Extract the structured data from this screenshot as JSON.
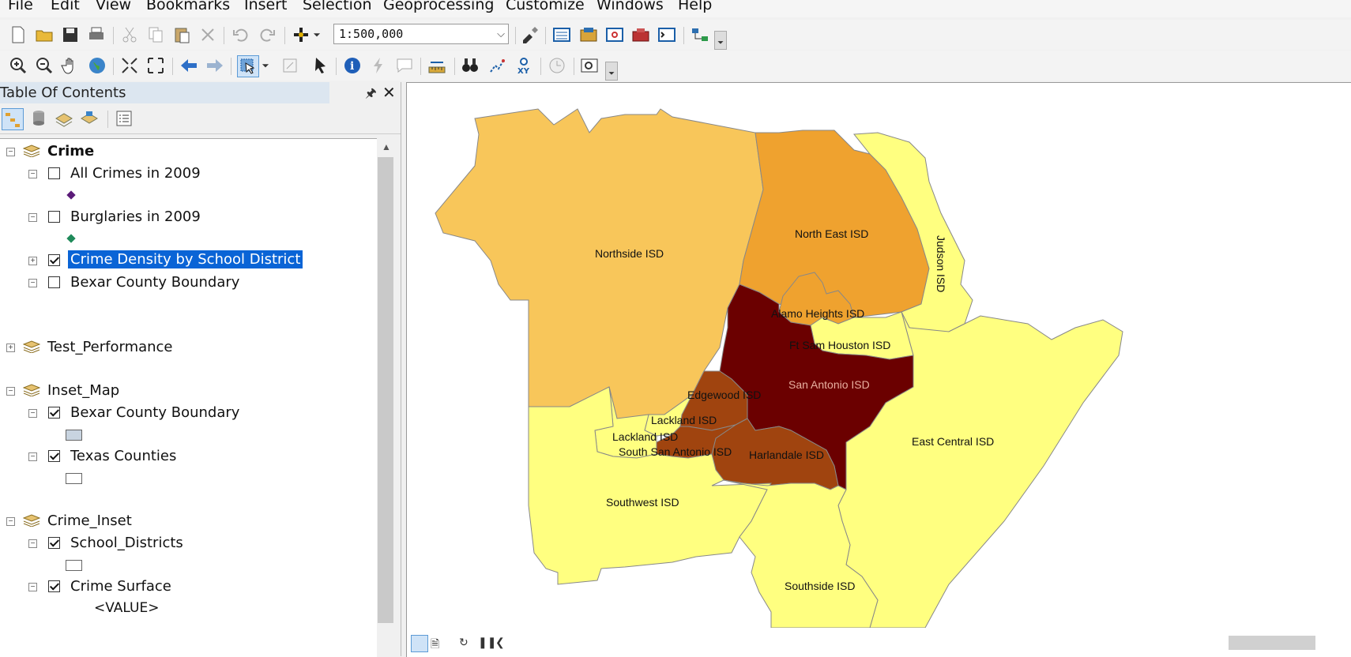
{
  "menu": [
    "File",
    "Edit",
    "View",
    "Bookmarks",
    "Insert",
    "Selection",
    "Geoprocessing",
    "Customize",
    "Windows",
    "Help"
  ],
  "toolbar": {
    "scale_value": "1:500,000"
  },
  "toc": {
    "title": "Table Of Contents",
    "groups": [
      {
        "name": "Crime",
        "expanded": true,
        "layers": [
          {
            "name": "All Crimes in 2009",
            "checked": false,
            "symbol_color": "#5b1a78",
            "symbol": "point"
          },
          {
            "name": "Burglaries in 2009",
            "checked": false,
            "symbol_color": "#1f8a5a",
            "symbol": "point"
          },
          {
            "name": "Crime Density by School District",
            "checked": true,
            "selected": true,
            "collapsed": true
          },
          {
            "name": "Bexar County Boundary",
            "checked": false
          }
        ]
      },
      {
        "name": "Test_Performance",
        "expanded": false,
        "layers": []
      },
      {
        "name": "Inset_Map",
        "expanded": true,
        "layers": [
          {
            "name": "Bexar County Boundary",
            "checked": true,
            "symbol_color": "#c8d4e0",
            "symbol": "box"
          },
          {
            "name": "Texas Counties",
            "checked": true,
            "symbol_color": "#ffffff",
            "symbol": "box"
          }
        ]
      },
      {
        "name": "Crime_Inset",
        "expanded": true,
        "layers": [
          {
            "name": "School_Districts",
            "checked": true,
            "symbol_color": "#ffffff",
            "symbol": "box"
          },
          {
            "name": "Crime Surface",
            "checked": true
          }
        ]
      }
    ],
    "value_label": "<VALUE>"
  },
  "map": {
    "colors": {
      "lightest": "#ffff80",
      "light": "#f8c65a",
      "medium": "#efa22f",
      "dark": "#a0440f",
      "darkest": "#6b0000"
    },
    "district_labels": {
      "northside": "Northside ISD",
      "northeast": "North East ISD",
      "judson": "Judson ISD",
      "alamo": "Alamo Heights ISD",
      "fortsam": "Ft Sam Houston ISD",
      "sanantonio": "San Antonio ISD",
      "edgewood": "Edgewood ISD",
      "lackland1": "Lackland ISD",
      "lackland2": "Lackland ISD",
      "ssa": "South San Antonio ISD",
      "harlandale": "Harlandale ISD",
      "eastcentral": "East Central ISD",
      "southwest": "Southwest ISD",
      "southside": "Southside ISD"
    }
  }
}
